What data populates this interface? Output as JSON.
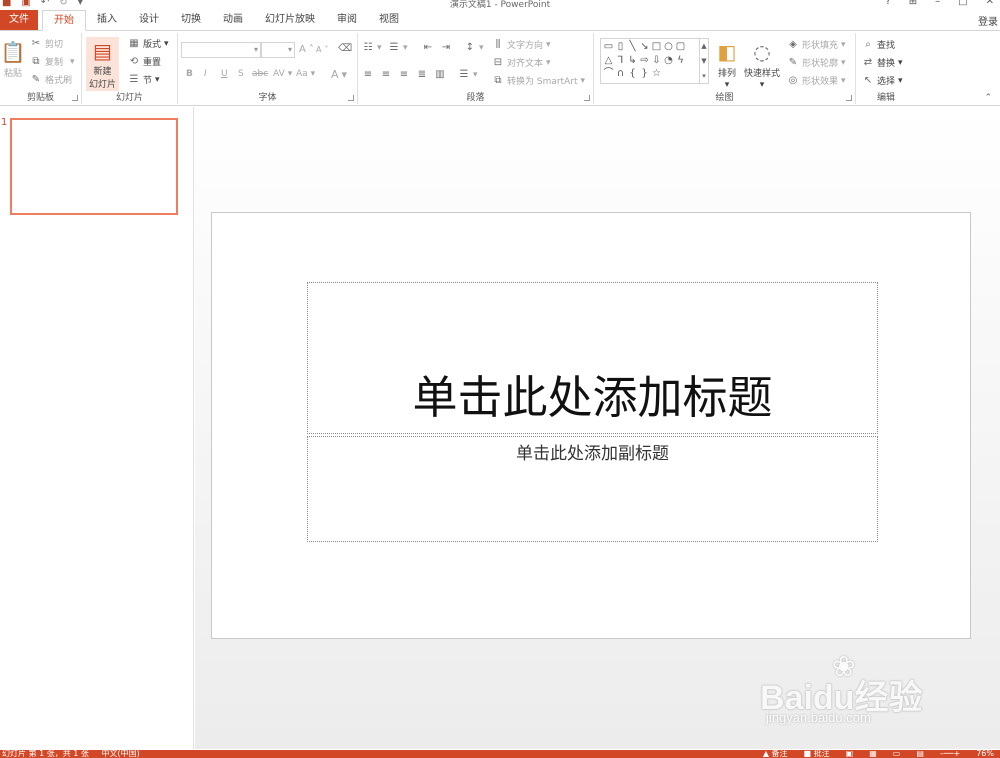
{
  "window": {
    "title": "演示文稿1 - PowerPoint",
    "help_glyph": "?",
    "login": "登录"
  },
  "qat": {
    "save_icon": "save-icon",
    "undo_icon": "undo-icon",
    "redo_icon": "redo-icon",
    "customize_icon": "customize-icon"
  },
  "tabs": [
    "文件",
    "开始",
    "插入",
    "设计",
    "切换",
    "动画",
    "幻灯片放映",
    "审阅",
    "视图"
  ],
  "active_tab": "开始",
  "ribbon": {
    "clipboard": {
      "paste": "粘贴",
      "cut": "剪切",
      "copy": "复制",
      "format_painter": "格式刷",
      "label": "剪贴板"
    },
    "slides": {
      "new_slide_line1": "新建",
      "new_slide_line2": "幻灯片",
      "layout": "版式",
      "reset": "重置",
      "section": "节",
      "label": "幻灯片"
    },
    "font": {
      "label": "字体",
      "bold": "B",
      "italic": "I",
      "underline": "U",
      "shadow": "S",
      "strike": "abc",
      "spacing": "AV",
      "case": "Aa",
      "color": "A",
      "grow": "A",
      "shrink": "A"
    },
    "paragraph": {
      "text_direction": "文字方向",
      "align_text": "对齐文本",
      "smartart": "转换为 SmartArt",
      "label": "段落"
    },
    "drawing": {
      "arrange": "排列",
      "quick_styles": "快速样式",
      "shape_fill": "形状填充",
      "shape_outline": "形状轮廓",
      "shape_effects": "形状效果",
      "label": "绘图"
    },
    "editing": {
      "find": "查找",
      "replace": "替换",
      "select": "选择",
      "label": "编辑"
    }
  },
  "thumbnail": {
    "number": "1"
  },
  "slide": {
    "title_placeholder": "单击此处添加标题",
    "subtitle_placeholder": "单击此处添加副标题"
  },
  "status": {
    "slide_info": "幻灯片 第 1 张，共 1 张",
    "language": "中文(中国)",
    "notes": "备注",
    "comments": "批注",
    "zoom": "76%"
  },
  "watermark": {
    "brand": "Baidu经验",
    "url": "jingyan.baidu.com"
  },
  "colors": {
    "accent": "#d24726",
    "thumb_border": "#ef7c5d"
  }
}
